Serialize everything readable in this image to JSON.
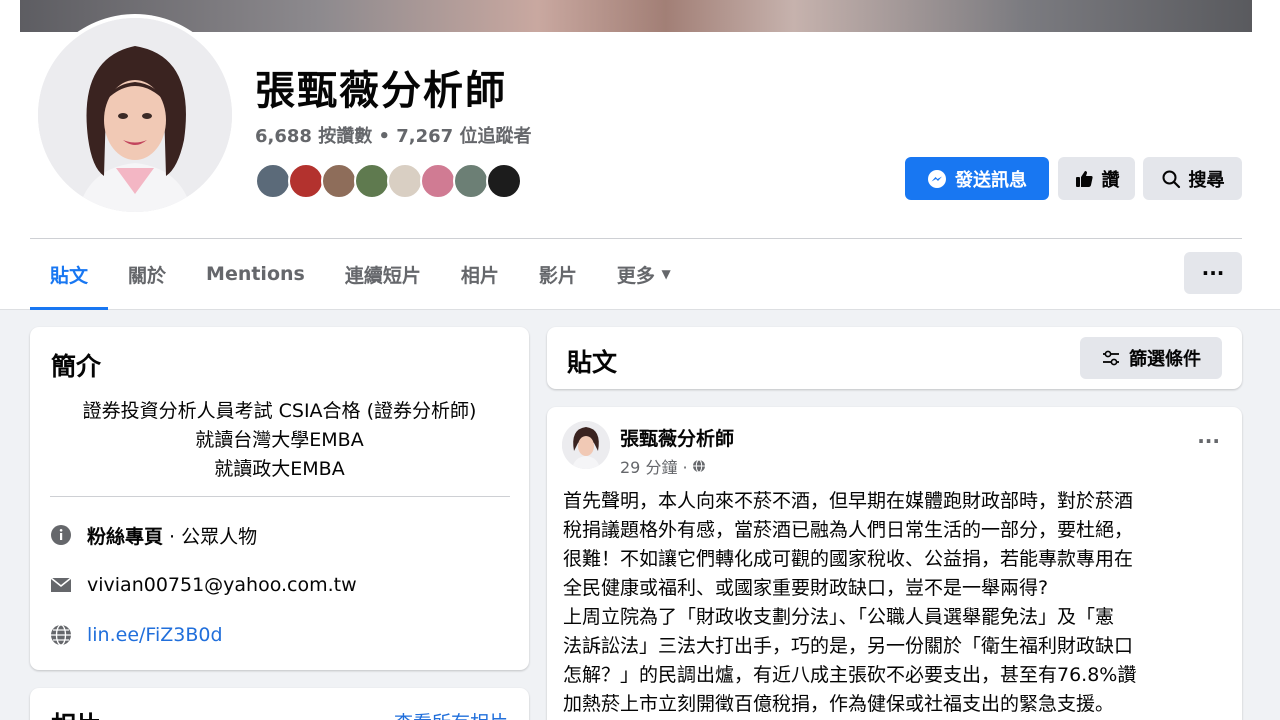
{
  "page": {
    "name": "張甄薇分析師",
    "stats": "6,688 按讚數 • 7,267 位追蹤者"
  },
  "actions": {
    "message": "發送訊息",
    "like": "讚",
    "search": "搜尋",
    "more": "···"
  },
  "tabs": [
    {
      "label": "貼文"
    },
    {
      "label": "關於"
    },
    {
      "label": "Mentions"
    },
    {
      "label": "連續短片"
    },
    {
      "label": "相片"
    },
    {
      "label": "影片"
    },
    {
      "label": "更多"
    }
  ],
  "intro": {
    "title": "簡介",
    "bio_lines": [
      "證券投資分析人員考試 CSIA合格 (證券分析師)",
      "就讀台灣大學EMBA",
      "就讀政大EMBA"
    ],
    "category_label": "粉絲專頁",
    "category_value": " · 公眾人物",
    "email": "vivian00751@yahoo.com.tw",
    "website": "lin.ee/FiZ3B0d"
  },
  "photos": {
    "title": "相片",
    "see_all": "查看所有相片"
  },
  "posts_section": {
    "title": "貼文",
    "filter": "篩選條件"
  },
  "post": {
    "author": "張甄薇分析師",
    "time": "29 分鐘 ·",
    "more": "···",
    "lines": [
      "首先聲明，本人向來不菸不酒，但早期在媒體跑財政部時，對於菸酒",
      "稅捐議題格外有感，當菸酒已融為人們日常生活的一部分，要杜絕，",
      "很難！不如讓它們轉化成可觀的國家稅收、公益捐，若能專款專用在",
      "全民健康或福利、或國家重要財政缺口，豈不是一舉兩得?",
      "上周立院為了「財政收支劃分法」、「公職人員選舉罷免法」及「憲",
      "法訴訟法」三法大打出手，巧的是，另一份關於「衛生福利財政缺口",
      "怎解？」的民調出爐，有近八成主張砍不必要支出，甚至有76.8%讚",
      "加熱菸上市立刻開徵百億稅捐，作為健保或社福支出的緊急支援。"
    ]
  },
  "colors": {
    "primary": "#1877f2",
    "link": "#216fdb",
    "secondary_text": "#65676b",
    "gray_button": "#e4e6eb"
  }
}
